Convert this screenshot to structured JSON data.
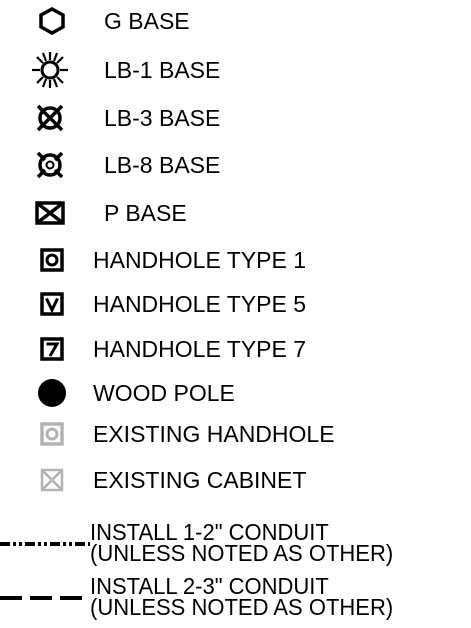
{
  "legend": {
    "items": [
      {
        "symbol": "hexagon-icon",
        "label": "G BASE"
      },
      {
        "symbol": "starburst-circle-icon",
        "label": "LB-1 BASE"
      },
      {
        "symbol": "crossed-circle-icon",
        "label": "LB-3 BASE"
      },
      {
        "symbol": "crossed-circle-dot-icon",
        "label": "LB-8 BASE"
      },
      {
        "symbol": "crossed-box-icon",
        "label": "P BASE"
      },
      {
        "symbol": "square-circle-icon",
        "label": "HANDHOLE TYPE 1"
      },
      {
        "symbol": "square-v-icon",
        "label": "HANDHOLE TYPE 5"
      },
      {
        "symbol": "square-seven-icon",
        "label": "HANDHOLE TYPE 7"
      },
      {
        "symbol": "filled-circle-icon",
        "label": "WOOD POLE"
      },
      {
        "symbol": "grey-square-circle-icon",
        "label": "EXISTING HANDHOLE"
      },
      {
        "symbol": "grey-crossed-box-icon",
        "label": "EXISTING CABINET"
      }
    ],
    "conduits": [
      {
        "line_style": "dash-dot-dot",
        "line1": "INSTALL 1-2\" CONDUIT",
        "line2": "(UNLESS NOTED AS OTHER)"
      },
      {
        "line_style": "long-dash",
        "line1": "INSTALL 2-3\" CONDUIT",
        "line2": "(UNLESS NOTED AS OTHER)"
      }
    ],
    "colors": {
      "ink": "#000000",
      "existing": "#b3b3b3"
    }
  }
}
